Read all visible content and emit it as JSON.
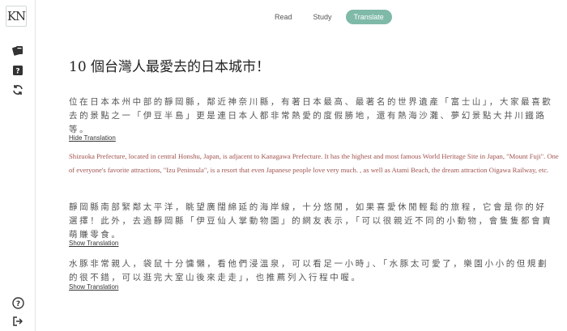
{
  "sidebar": {
    "logo": "KN",
    "icons": [
      "flashcards-icon",
      "quiz-icon",
      "refresh-icon",
      "help-icon",
      "logout-icon"
    ]
  },
  "tabs": [
    {
      "label": "Read",
      "active": false
    },
    {
      "label": "Study",
      "active": false
    },
    {
      "label": "Translate",
      "active": true
    }
  ],
  "accent_color": "#7fb9a7",
  "translation_color": "#a0524f",
  "article": {
    "title": "10 個台灣人最愛去的日本城市！",
    "paragraphs": [
      {
        "text": "位在日本本州中部的靜岡縣，鄰近神奈川縣，有著日本最高、最著名的世界遺產「富士山」，大家最喜歡去的景點之一「伊豆半島」更是連日本人都非常熱愛的度假勝地，還有熱海沙灘、夢幻景點大井川鐵路等。",
        "toggle": "Hide Translation",
        "translation": "Shizuoka Prefecture, located in central Honshu, Japan, is adjacent to Kanagawa Prefecture. It has the highest and most famous World Heritage Site in Japan, \"Mount Fuji\". One of everyone's favorite attractions, \"Izu Peninsula\", is a resort that even Japanese people love very much. , as well as Atami Beach, the dream attraction Oigawa Railway, etc."
      },
      {
        "text": "靜岡縣南部緊鄰太平洋，眺望廣闊綿延的海岸線，十分悠閒，如果喜愛休閒輕鬆的旅程，它會是你的好選擇！此外，去過靜岡縣「伊豆仙人掌動物園」的網友表示，「可以很親近不同的小動物，會隻隻都會賣萌賺零食。",
        "toggle": "Show Translation",
        "translation": ""
      },
      {
        "text": "水豚非常親人，袋鼠十分慵懶，看他們浸溫泉，可以看足一小時」、「水豚太可愛了，樂園小小的但規劃的很不錯，可以逛完大室山後來走走」，也推薦列入行程中喔。",
        "toggle": "Show Translation",
        "translation": ""
      }
    ]
  }
}
